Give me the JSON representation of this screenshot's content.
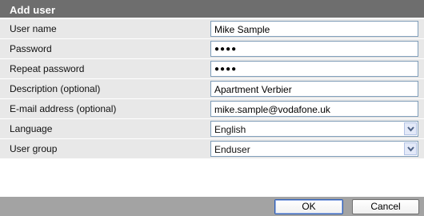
{
  "dialog": {
    "title": "Add user"
  },
  "fields": {
    "username": {
      "label": "User name",
      "value": "Mike Sample"
    },
    "password": {
      "label": "Password",
      "value": "●●●●"
    },
    "repeat_password": {
      "label": "Repeat password",
      "value": "●●●●"
    },
    "description": {
      "label": "Description (optional)",
      "value": "Apartment Verbier"
    },
    "email": {
      "label": "E-mail address (optional)",
      "value": "mike.sample@vodafone.uk"
    },
    "language": {
      "label": "Language",
      "value": "English"
    },
    "user_group": {
      "label": "User group",
      "value": "Enduser"
    }
  },
  "buttons": {
    "ok": "OK",
    "cancel": "Cancel"
  },
  "icons": {
    "dropdown": "chevron-down-icon"
  },
  "colors": {
    "header_bg": "#6e6e6e",
    "row_bg": "#e8e8e8",
    "footer_bg": "#a3a3a3",
    "input_border": "#7f9db9"
  }
}
